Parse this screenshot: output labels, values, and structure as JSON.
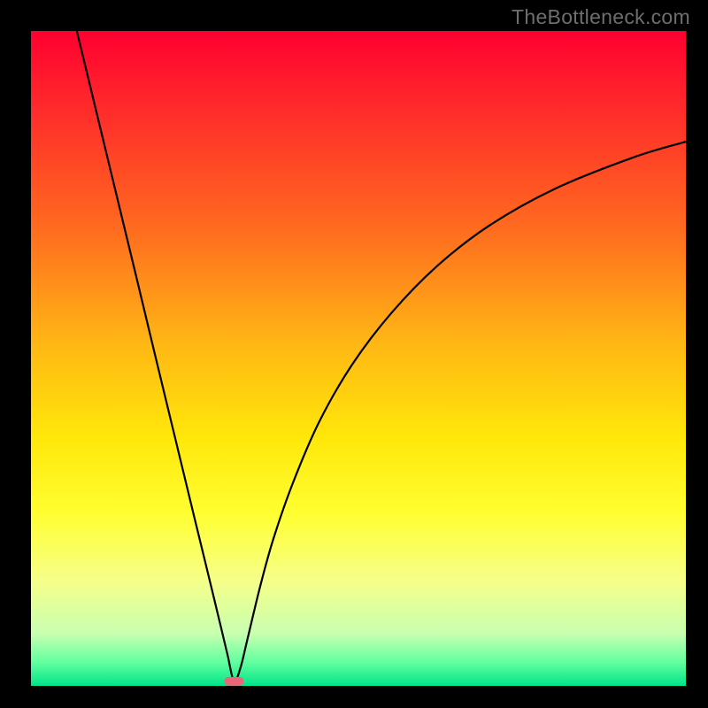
{
  "watermark": "TheBottleneck.com",
  "chart_data": {
    "type": "line",
    "title": "",
    "xlabel": "",
    "ylabel": "",
    "xlim": [
      0,
      100
    ],
    "ylim": [
      0,
      100
    ],
    "gradient_stops": [
      {
        "offset": 0.0,
        "color": "#ff0030"
      },
      {
        "offset": 0.12,
        "color": "#ff2b2b"
      },
      {
        "offset": 0.3,
        "color": "#ff6a1f"
      },
      {
        "offset": 0.48,
        "color": "#ffb814"
      },
      {
        "offset": 0.62,
        "color": "#ffe70a"
      },
      {
        "offset": 0.74,
        "color": "#ffff33"
      },
      {
        "offset": 0.84,
        "color": "#f6ff8a"
      },
      {
        "offset": 0.92,
        "color": "#c8ffb0"
      },
      {
        "offset": 0.965,
        "color": "#5fff9e"
      },
      {
        "offset": 1.0,
        "color": "#00e48a"
      }
    ],
    "series": [
      {
        "name": "bottleneck-curve",
        "comment": "V-shaped curve with minimum near x≈31",
        "x": [
          7,
          10,
          13,
          16,
          19,
          22,
          25,
          27,
          29,
          30,
          31,
          32,
          33,
          35,
          37,
          40,
          44,
          49,
          55,
          62,
          70,
          80,
          92,
          100
        ],
        "y": [
          100,
          87.6,
          75.2,
          62.8,
          50.3,
          37.9,
          25.5,
          17.3,
          9.0,
          4.8,
          0.7,
          2.8,
          6.9,
          15.2,
          22.4,
          31.0,
          40.3,
          49.0,
          56.9,
          64.1,
          70.3,
          75.9,
          80.7,
          83.1
        ]
      }
    ],
    "marker": {
      "comment": "small red-pink marker at curve minimum",
      "x": 31,
      "y": 0.7,
      "color": "#e8687a"
    }
  }
}
